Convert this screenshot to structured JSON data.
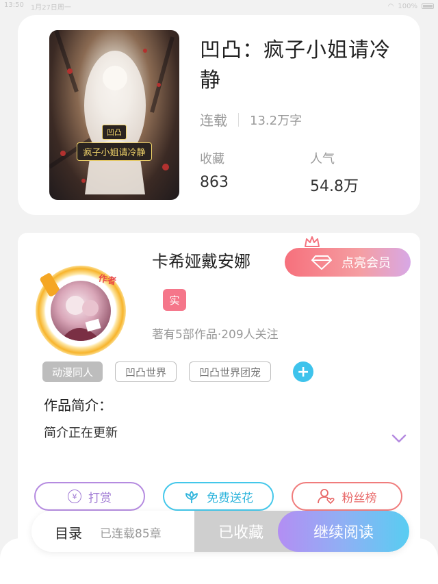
{
  "status_bar": {
    "time": "13:50",
    "date": "1月27日周一",
    "battery": "100%"
  },
  "book": {
    "title": "凹凸：疯子小姐请冷静",
    "status": "连载",
    "word_count": "13.2万字",
    "favorites_label": "收藏",
    "favorites_value": "863",
    "popularity_label": "人气",
    "popularity_value": "54.8万",
    "cover_text_small": "凹凸",
    "cover_text_big": "疯子小姐请冷静"
  },
  "author": {
    "name": "卡希娅戴安娜",
    "avatar_tag": "作者",
    "real_badge": "实",
    "stats": "著有5部作品·209人关注",
    "vip_button": "点亮会员"
  },
  "tags": [
    "动漫同人",
    "凹凸世界",
    "凹凸世界团宠"
  ],
  "tag_add": "+",
  "intro": {
    "title": "作品简介：",
    "text": "简介正在更新"
  },
  "actions": {
    "reward": "打赏",
    "reward_icon": "¥",
    "flower": "免费送花",
    "fans": "粉丝榜"
  },
  "bottom_bar": {
    "toc": "目录",
    "chapters": "已连载85章",
    "collected": "已收藏",
    "continue": "继续阅读"
  },
  "colors": {
    "vip_gradient_start": "#f6707c",
    "read_gradient_start": "#b38ef3",
    "read_gradient_end": "#58cdf2",
    "tag_add": "#3ec3ec"
  }
}
